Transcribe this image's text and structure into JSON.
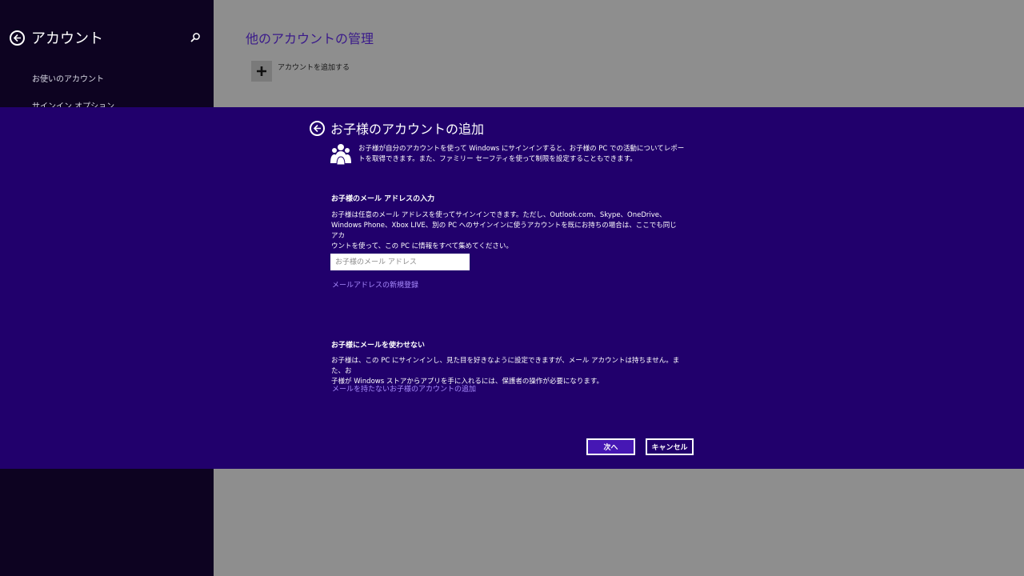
{
  "sidebar": {
    "title": "アカウント",
    "items": [
      {
        "label": "お使いのアカウント"
      },
      {
        "label": "サインイン オプション"
      }
    ]
  },
  "main": {
    "title": "他のアカウントの管理",
    "add_account_label": "アカウントを追加する"
  },
  "dialog": {
    "title": "お子様のアカウントの追加",
    "intro_line1": "お子様が自分のアカウントを使って Windows にサインインすると、お子様の PC での活動についてレポー",
    "intro_line2": "トを取得できます。また、ファミリー セーフティを使って制限を設定することもできます。",
    "email_section": {
      "heading": "お子様のメール アドレスの入力",
      "line1": "お子様は任意のメール アドレスを使ってサインインできます。ただし、Outlook.com、Skype、OneDrive、",
      "line2": "Windows Phone、Xbox LIVE、別の PC へのサインインに使うアカウントを既にお持ちの場合は、ここでも同じアカ",
      "line3": "ウントを使って、この PC に情報をすべて集めてください。",
      "placeholder": "お子様のメール アドレス",
      "value": "",
      "signup_link": "メールアドレスの新規登録"
    },
    "no_email_section": {
      "heading": "お子様にメールを使わせない",
      "line1": "お子様は、この PC にサインインし、見た目を好きなように設定できますが、メール アカウントは持ちません。また、お",
      "line2": "子様が Windows ストアからアプリを手に入れるには、保護者の操作が必要になります。",
      "link": "メールを持たないお子様のアカウントの追加"
    },
    "next_button": "次へ",
    "cancel_button": "キャンセル"
  },
  "colors": {
    "dialog_bg": "#21006c",
    "sidebar_bg": "#0d0321",
    "accent": "#4617b4",
    "link": "#a98bff"
  },
  "icons": [
    "back-icon",
    "search-icon",
    "plus-icon",
    "family-icon"
  ]
}
